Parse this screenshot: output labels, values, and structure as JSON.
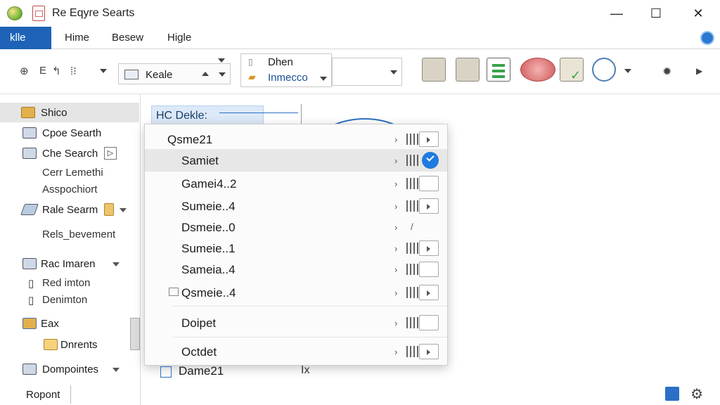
{
  "window": {
    "title": "Re Eqyre Searts",
    "minimize": "—",
    "maximize": "☐",
    "close": "✕"
  },
  "tabs": [
    "klle",
    "Hime",
    "Besew",
    "Higle"
  ],
  "toolbar": {
    "left_glyphs": [
      "⊕",
      "E",
      "↰",
      "⁞⁝"
    ],
    "combo1_label": "Keale",
    "combo2_top": "Dhen",
    "combo2_bottom": "Inmecco"
  },
  "sidebar": {
    "items": [
      {
        "label": "Shico",
        "selected": true
      },
      {
        "label": "Cpoe Searth"
      },
      {
        "label": "Che Search"
      },
      {
        "label": "Cerr Lemethi"
      },
      {
        "label": "Asspochiort"
      },
      {
        "label": "Rale Searm"
      },
      {
        "label": "Rels_bevement"
      },
      {
        "label": "Rac Imaren"
      },
      {
        "label": "Red imton"
      },
      {
        "label": "Denimton"
      },
      {
        "label": "Eax"
      },
      {
        "label": "Dnrents"
      },
      {
        "label": "Dompointes"
      },
      {
        "label": "Ropont"
      }
    ]
  },
  "content": {
    "header": "HC Dekle:",
    "bottom_item": "Dame21",
    "bottom_ix": "Ix"
  },
  "menu": {
    "items": [
      {
        "label": "Qsme21",
        "check": "arrow"
      },
      {
        "label": "Samiet",
        "check": "on",
        "highlight": true
      },
      {
        "label": "Gamei4..2",
        "check": "empty"
      },
      {
        "label": "Sumeie..4",
        "check": "arrow"
      },
      {
        "label": "Dsmeie..0",
        "check": "none"
      },
      {
        "label": "Sumeie..1",
        "check": "arrow"
      },
      {
        "label": "Sameia..4",
        "check": "empty"
      },
      {
        "label": "Qsmeie..4",
        "check": "arrow"
      },
      {
        "label": "Doipet",
        "check": "empty"
      },
      {
        "label": "Octdet",
        "check": "arrow"
      }
    ]
  },
  "colors": {
    "accent": "#1e63b8",
    "selection": "#e5e5e5",
    "check_on": "#1f7be0"
  }
}
